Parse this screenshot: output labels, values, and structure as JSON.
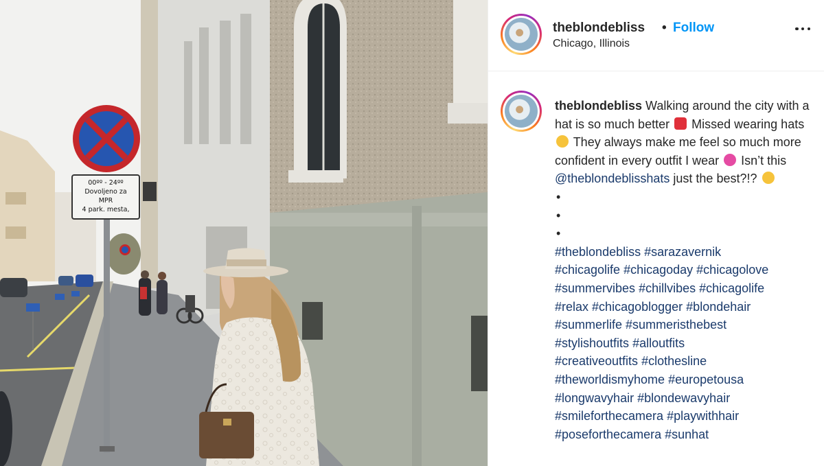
{
  "post": {
    "username": "theblondebliss",
    "separator": "•",
    "follow_label": "Follow",
    "location": "Chicago, Illinois",
    "more_icon": "more-horizontal-icon"
  },
  "photo": {
    "sign_line1": "00ºº - 24ºº",
    "sign_line2": "Dovoljeno za",
    "sign_line3": "MPR",
    "sign_line4": "4 park. mesta,"
  },
  "caption": {
    "username": "theblondebliss",
    "text1": "Walking around the city with a hat is so much better",
    "emoji1": "siren-emoji",
    "text2": "Missed wearing hats",
    "emoji2": "pleading-face-emoji",
    "text3": "They always make me feel so much more confident in every outfit I wear",
    "emoji3": "revolving-hearts-emoji",
    "text4": "Isn’t this",
    "mention": "@theblondeblisshats",
    "text5": "just the best?!?",
    "emoji4": "star-struck-emoji",
    "bullets": [
      "•",
      "•",
      "•"
    ],
    "hashtags": [
      "#theblondebliss",
      "#sarazavernik",
      "#chicagolife",
      "#chicagoday",
      "#chicagolove",
      "#summervibes",
      "#chillvibes",
      "#chicagolife",
      "#relax",
      "#chicagoblogger",
      "#blondehair",
      "#summerlife",
      "#summeristhebest",
      "#stylishoutfits",
      "#alloutfits",
      "#creativeoutfits",
      "#clothesline",
      "#theworldismyhome",
      "#europetousa",
      "#longwavyhair",
      "#blondewavyhair",
      "#smileforthecamera",
      "#playwithhair",
      "#poseforthecamera",
      "#sunhat"
    ]
  },
  "colors": {
    "follow": "#0095f6",
    "link": "#1a3a6b",
    "text": "#262626",
    "border": "#efefef"
  }
}
